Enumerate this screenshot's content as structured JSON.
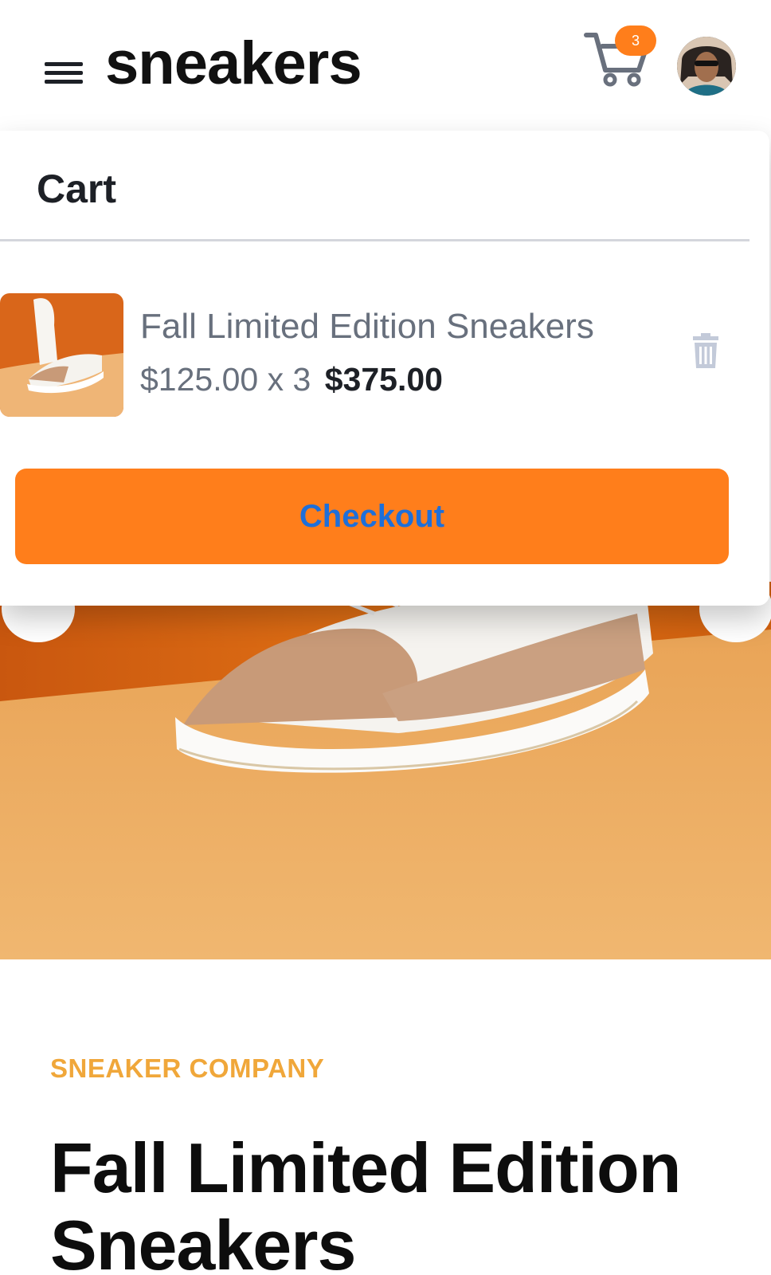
{
  "header": {
    "logo": "sneakers",
    "cart_count": "3",
    "icons": {
      "menu": "hamburger-menu-icon",
      "cart": "shopping-cart-icon",
      "avatar": "user-avatar"
    }
  },
  "cart": {
    "title": "Cart",
    "items": [
      {
        "name": "Fall Limited Edition Sneakers",
        "unit_price": "$125.00",
        "quantity_text": "x 3",
        "total": "$375.00",
        "delete_icon": "trash-icon"
      }
    ],
    "checkout_label": "Checkout"
  },
  "product": {
    "company": "SNEAKER COMPANY",
    "title": "Fall Limited Edition Sneakers"
  },
  "colors": {
    "accent_orange": "#ff7e1b",
    "brand_text": "#f0a73a",
    "checkout_text": "#1e6fd9",
    "muted_text": "#68707d",
    "dark_text": "#1d2026"
  }
}
